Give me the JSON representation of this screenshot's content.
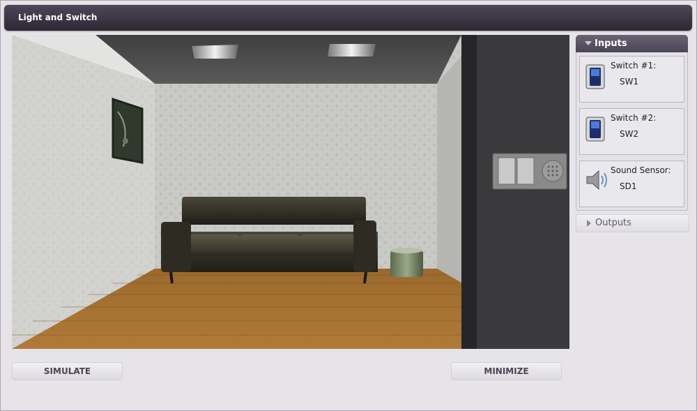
{
  "window": {
    "title": "Light and Switch"
  },
  "buttons": {
    "simulate": "SIMULATE",
    "minimize": "MINIMIZE"
  },
  "inputs_panel": {
    "header": "Inputs",
    "items": [
      {
        "title": "Switch #1:",
        "value": "SW1",
        "icon": "switch-icon"
      },
      {
        "title": "Switch #2:",
        "value": "SW2",
        "icon": "switch-icon"
      },
      {
        "title": "Sound Sensor:",
        "value": "SD1",
        "icon": "speaker-icon"
      }
    ]
  },
  "outputs_panel": {
    "header": "Outputs"
  }
}
